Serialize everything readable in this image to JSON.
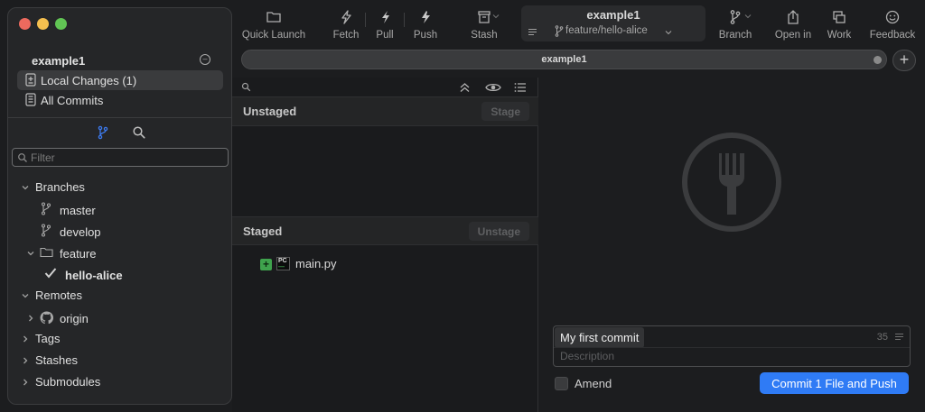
{
  "repo": {
    "name": "example1"
  },
  "sidebar": {
    "local_changes": "Local Changes (1)",
    "all_commits": "All Commits",
    "filter_placeholder": "Filter",
    "branches_label": "Branches",
    "branches": [
      "master",
      "develop"
    ],
    "feature_folder": "feature",
    "current_branch": "hello-alice",
    "remotes_label": "Remotes",
    "remote_origin": "origin",
    "tags_label": "Tags",
    "stashes_label": "Stashes",
    "submodules_label": "Submodules"
  },
  "toolbar": {
    "quick_launch": "Quick Launch",
    "fetch": "Fetch",
    "pull": "Pull",
    "push": "Push",
    "stash": "Stash",
    "branch": "Branch",
    "open_in": "Open in",
    "work": "Work",
    "feedback": "Feedback",
    "repo_title": "example1",
    "branch_path": "feature/hello-alice"
  },
  "tabbar": {
    "tab": "example1"
  },
  "changes": {
    "unstaged_label": "Unstaged",
    "stage_button": "Stage",
    "staged_label": "Staged",
    "unstage_button": "Unstage",
    "staged_files": [
      {
        "name": "main.py",
        "status": "added"
      }
    ]
  },
  "commit": {
    "summary": "My first commit",
    "char_count": "35",
    "description_placeholder": "Description",
    "amend_label": "Amend",
    "commit_button": "Commit 1 File and Push"
  },
  "colors": {
    "accent": "#2f7bf5",
    "added": "#3fa34d",
    "branch_icon": "#3d7bf0"
  }
}
